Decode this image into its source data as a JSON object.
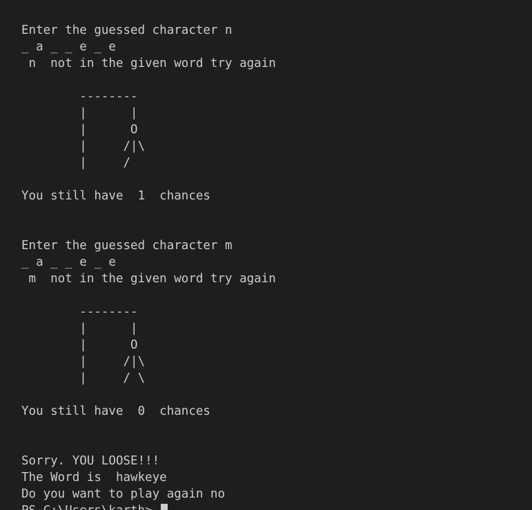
{
  "terminal": {
    "lines": [
      "Enter the guessed character n",
      "_ a _ _ e _ e",
      " n  not in the given word try again",
      "        --------",
      "        |      |",
      "        |      O",
      "        |     /|\\",
      "        |     /",
      "You still have  1  chances",
      "Enter the guessed character m",
      "_ a _ _ e _ e",
      " m  not in the given word try again",
      "        --------",
      "        |      |",
      "        |      O",
      "        |     /|\\",
      "        |     / \\",
      "You still have  0  chances",
      "Sorry. YOU LOOSE!!!",
      "The Word is  hawkeye",
      "Do you want to play again no",
      "PS C:\\Users\\karth> "
    ]
  }
}
